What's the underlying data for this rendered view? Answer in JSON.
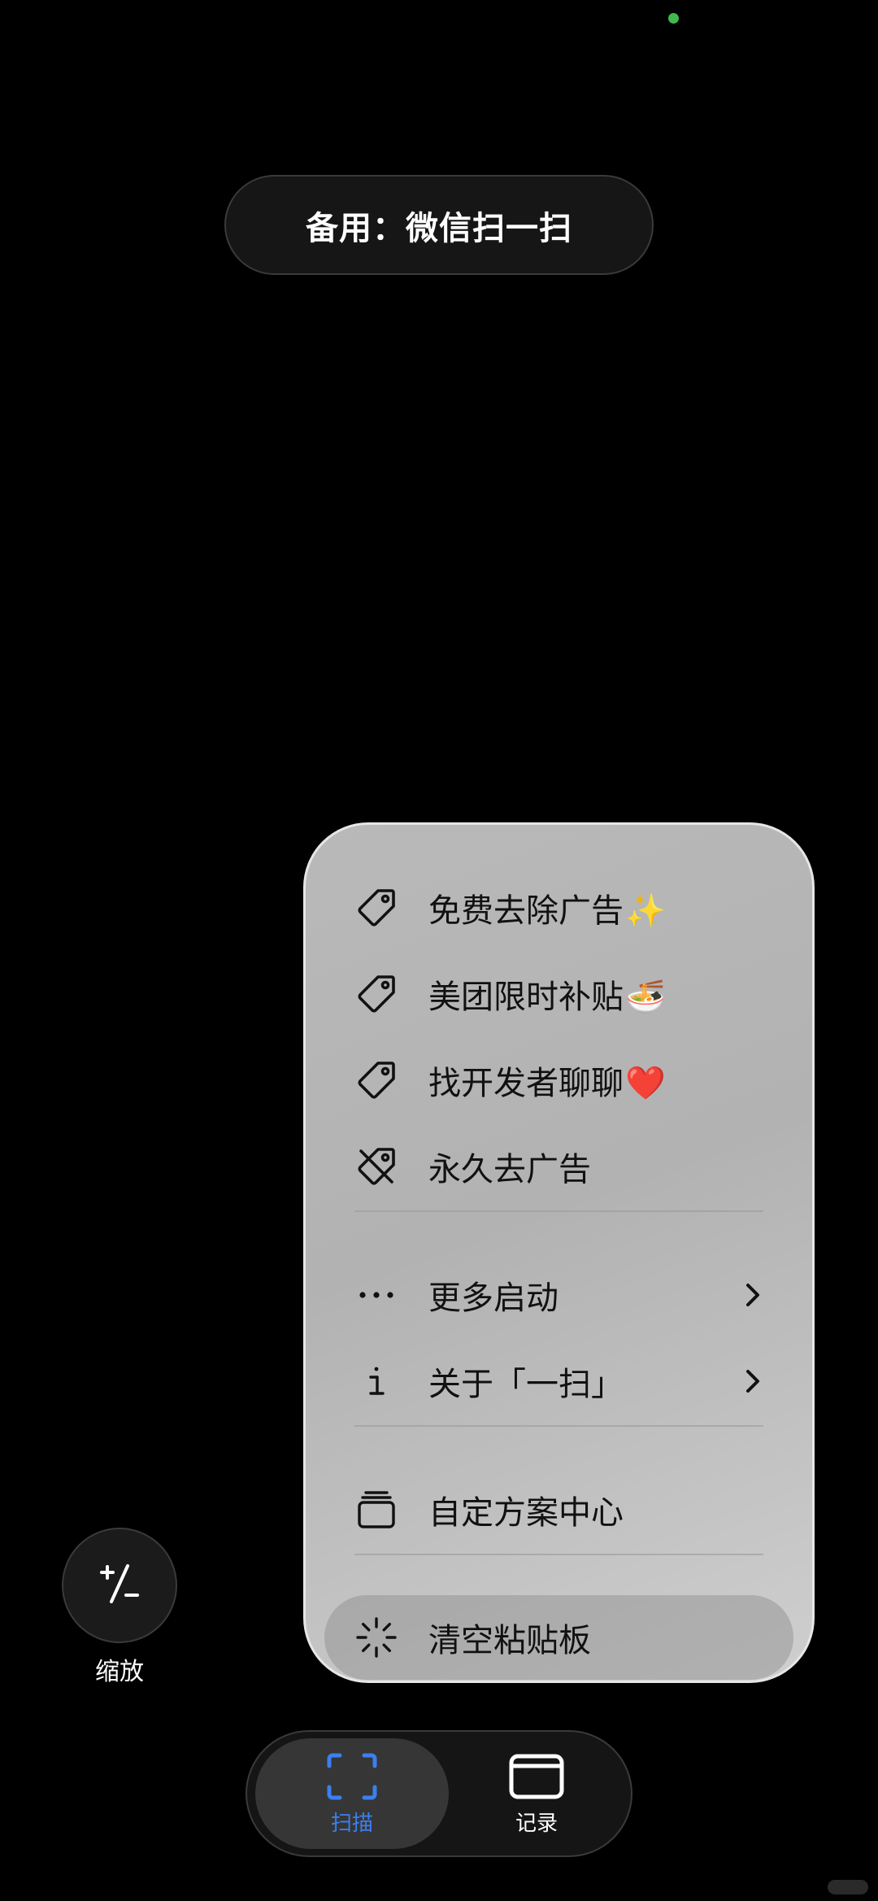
{
  "banner": {
    "text": "备用：微信扫一扫"
  },
  "menu": {
    "items": [
      {
        "label": "免费去除广告",
        "emoji": "✨",
        "icon": "tag-icon"
      },
      {
        "label": "美团限时补贴",
        "emoji": "🍜",
        "icon": "tag-icon"
      },
      {
        "label": "找开发者聊聊",
        "emoji": "❤️",
        "icon": "tag-icon"
      },
      {
        "label": "永久去广告",
        "icon": "tag-slash-icon"
      },
      {
        "label": "更多启动",
        "icon": "ellipsis-icon",
        "chevron": true
      },
      {
        "label": "关于「一扫」",
        "icon": "info-icon",
        "chevron": true
      },
      {
        "label": "自定方案中心",
        "icon": "stack-icon"
      },
      {
        "label": "清空粘贴板",
        "icon": "spinner-icon",
        "highlighted": true
      }
    ]
  },
  "zoom": {
    "icon_text": "+/−",
    "label": "缩放"
  },
  "tabbar": {
    "tabs": [
      {
        "label": "扫描",
        "icon": "scan-frame-icon",
        "active": true
      },
      {
        "label": "记录",
        "icon": "window-icon",
        "active": false
      }
    ]
  },
  "colors": {
    "accent": "#3b7ff0",
    "background": "#000000",
    "menu_bg": "#b8b8b8",
    "status_dot": "#3fb950"
  }
}
